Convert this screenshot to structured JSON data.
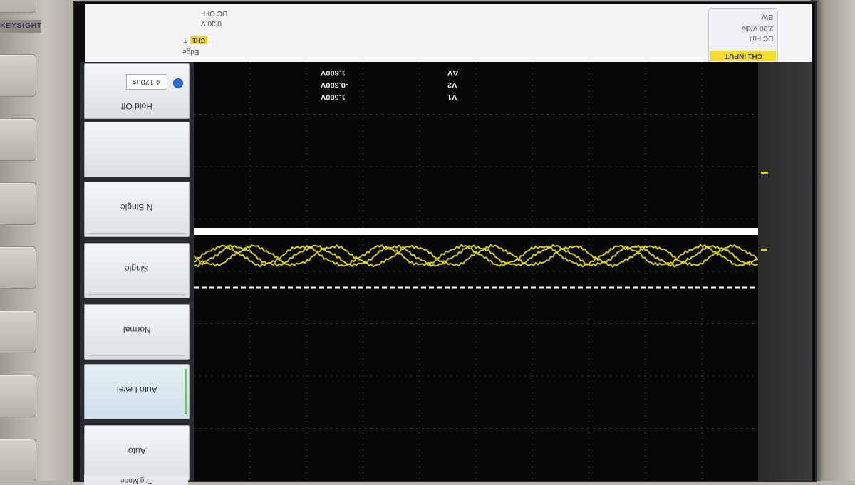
{
  "brand": "KEYSIGHT",
  "top_bar": {
    "trigger": {
      "mode_label": "Edge",
      "source_badge": "CH1",
      "source_symbol": "⇡",
      "level": "0.30 V",
      "coupling": "DC OFF"
    },
    "channel_box": {
      "label": "CH1 INPUT",
      "line1": "DC Full",
      "line2": "2.00 V/div",
      "line3": "BW"
    }
  },
  "softkeys": {
    "menu_title": "Trig Mode",
    "holdoff_label": "Hold Off",
    "holdoff_value": "4 120us",
    "n_single": "N Single",
    "single": "Single",
    "normal": "Normal",
    "auto_level": "Auto Level",
    "auto": "Auto"
  },
  "measurements": {
    "labels": [
      "V1",
      "V2",
      "ΔV"
    ],
    "values": [
      "1.500V",
      "-0.300V",
      "1.800V"
    ]
  },
  "colors": {
    "trace": "#e7df2a",
    "cursor": "#ffffff",
    "grid": "#3a3a3a",
    "channel_badge": "#f4d516",
    "active_indicator": "#55d04a"
  }
}
